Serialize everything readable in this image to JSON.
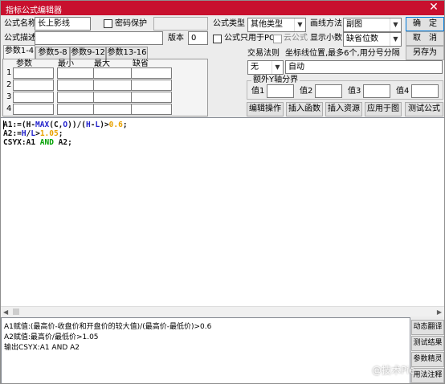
{
  "window": {
    "title": "指标公式编辑器",
    "close_symbol": "✕"
  },
  "formula": {
    "name_label": "公式名称",
    "name_value": "长上影线",
    "password_label": "密码保护",
    "password_value": "",
    "desc_label": "公式描述",
    "desc_value": "",
    "version_label": "版本",
    "version_value": "0",
    "type_label": "公式类型",
    "type_value": "其他类型",
    "draw_label": "画线方法",
    "draw_value": "副图",
    "pc_only_label": "公式只用于PC",
    "cloud_label": "云公式",
    "decimals_label": "显示小数",
    "decimals_value": "缺省位数"
  },
  "buttons": {
    "ok": "确　定",
    "cancel": "取　消",
    "save_as": "另存为",
    "edit_op": "编辑操作",
    "insert_func": "插入函数",
    "insert_res": "插入资源",
    "apply_chart": "应用于图",
    "test_formula": "测试公式"
  },
  "trade_rule": {
    "label": "交易法则",
    "value": "无",
    "coord_label": "坐标线位置,最多6个,用分号分隔",
    "coord_value": "自动"
  },
  "y_axis": {
    "group_label": "额外Y轴分界",
    "v1": "值1",
    "v2": "值2",
    "v3": "值3",
    "v4": "值4"
  },
  "tabs": [
    "参数1-4",
    "参数5-8",
    "参数9-12",
    "参数13-16"
  ],
  "params": {
    "headers": [
      "参数",
      "最小",
      "最大",
      "缺省"
    ],
    "rows": [
      "1",
      "2",
      "3",
      "4"
    ]
  },
  "code": {
    "l1": [
      {
        "t": "A1:=(H-",
        "c": "dark"
      },
      {
        "t": "MAX",
        "c": "blue"
      },
      {
        "t": "(C,",
        "c": "dark"
      },
      {
        "t": "O",
        "c": "blue"
      },
      {
        "t": "))/(",
        "c": "dark"
      },
      {
        "t": "H",
        "c": "blue"
      },
      {
        "t": "-",
        "c": "dark"
      },
      {
        "t": "L",
        "c": "blue"
      },
      {
        "t": ")>",
        "c": "dark"
      },
      {
        "t": "0.6",
        "c": "orange"
      },
      {
        "t": ";",
        "c": "dark"
      }
    ],
    "l2": [
      {
        "t": "A2:=",
        "c": "dark"
      },
      {
        "t": "H",
        "c": "blue"
      },
      {
        "t": "/",
        "c": "dark"
      },
      {
        "t": "L",
        "c": "blue"
      },
      {
        "t": ">",
        "c": "dark"
      },
      {
        "t": "1.05",
        "c": "orange"
      },
      {
        "t": ";",
        "c": "dark"
      }
    ],
    "l3": [
      {
        "t": "CSYX:A1 ",
        "c": "dark"
      },
      {
        "t": "AND",
        "c": "green"
      },
      {
        "t": " A2;",
        "c": "dark"
      }
    ]
  },
  "output": {
    "line1": "A1赋值:(最高价-收盘价和开盘价的较大值)/(最高价-最低价)>0.6",
    "line2": "A2赋值:最高价/最低价>1.05",
    "line3": "输出CSYX:A1 AND A2"
  },
  "side_buttons": {
    "translate": "动态翻译",
    "test_result": "测试结果",
    "wizard": "参数精灵",
    "usage": "用法注释"
  },
  "watermark": "@技术Pie",
  "colors": {
    "title_bar": "#c8102e",
    "keyword_blue": "#1e1ecc",
    "number_orange": "#e8a200",
    "logic_green": "#00a000"
  }
}
